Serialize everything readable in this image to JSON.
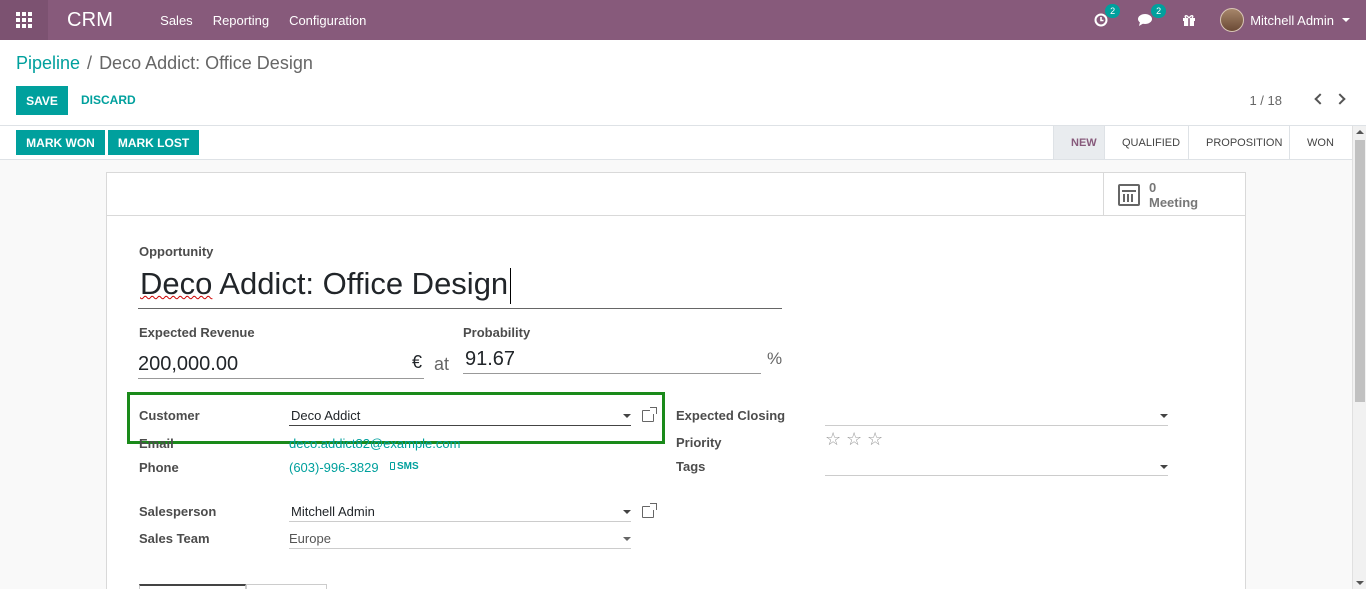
{
  "navbar": {
    "brand": "CRM",
    "menu": [
      "Sales",
      "Reporting",
      "Configuration"
    ],
    "activity_badge": "2",
    "messages_badge": "2",
    "user": "Mitchell Admin"
  },
  "control_panel": {
    "breadcrumb_parent": "Pipeline",
    "breadcrumb_separator": "/",
    "breadcrumb_current": "Deco Addict: Office Design",
    "save": "SAVE",
    "discard": "DISCARD",
    "pager": "1 / 18"
  },
  "statusbar": {
    "mark_won": "MARK WON",
    "mark_lost": "MARK LOST",
    "stages": [
      "NEW",
      "QUALIFIED",
      "PROPOSITION",
      "WON"
    ],
    "active_stage": "NEW"
  },
  "button_box": {
    "meeting_count": "0",
    "meeting_label": "Meeting"
  },
  "form": {
    "opportunity_label": "Opportunity",
    "opportunity_title_a": "Deco",
    "opportunity_title_b": " Addict: Office Design",
    "expected_revenue_label": "Expected Revenue",
    "expected_revenue": "200,000.00",
    "currency": "€",
    "at": "at",
    "probability_label": "Probability",
    "probability": "91.67",
    "percent": "%",
    "customer_label": "Customer",
    "customer": "Deco Addict",
    "email_label": "Email",
    "email": "deco.addict82@example.com",
    "phone_label": "Phone",
    "phone": "(603)-996-3829",
    "sms": "SMS",
    "expected_closing_label": "Expected Closing",
    "priority_label": "Priority",
    "tags_label": "Tags",
    "salesperson_label": "Salesperson",
    "salesperson": "Mitchell Admin",
    "sales_team_label": "Sales Team",
    "sales_team": "Europe"
  },
  "colors": {
    "navbar": "#875a7b",
    "accent": "#00a09d",
    "highlight_box": "#1a8a1a"
  }
}
